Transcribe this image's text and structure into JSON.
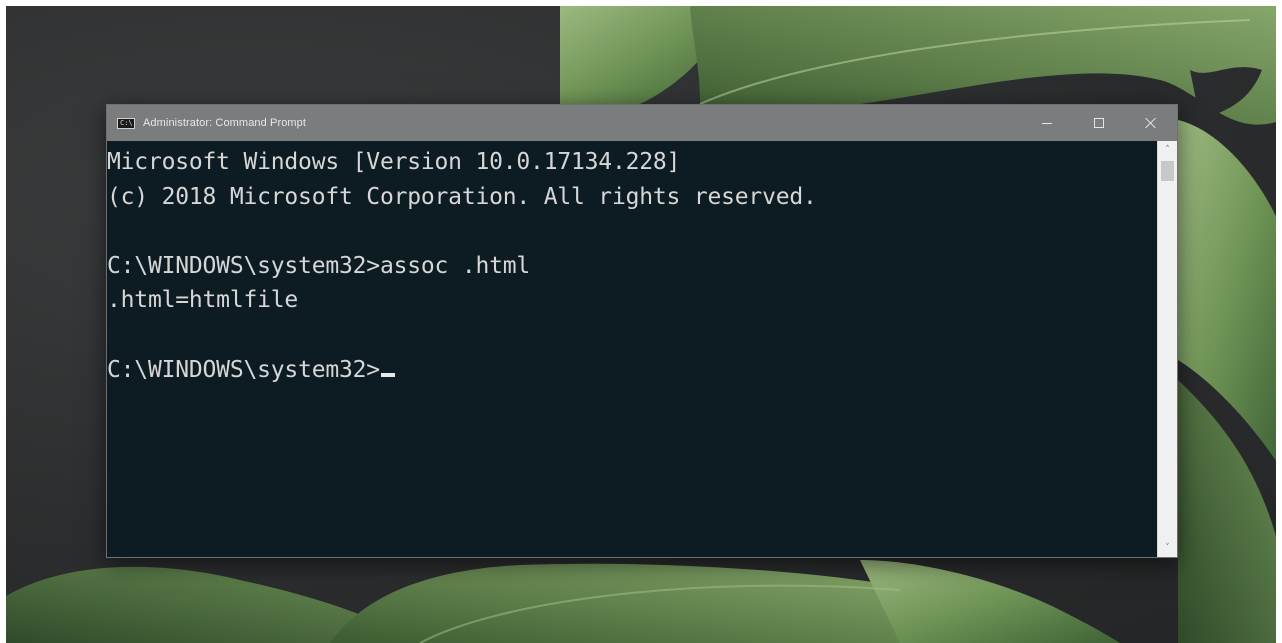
{
  "window": {
    "title": "Administrator: Command Prompt",
    "icon_label": "C:\\",
    "controls": {
      "minimize": "minimize-icon",
      "maximize": "maximize-icon",
      "close": "close-icon"
    }
  },
  "console": {
    "lines": [
      "Microsoft Windows [Version 10.0.17134.228]",
      "(c) 2018 Microsoft Corporation. All rights reserved.",
      "",
      "C:\\WINDOWS\\system32>assoc .html",
      ".html=htmlfile",
      "",
      "C:\\WINDOWS\\system32>"
    ]
  },
  "scrollbar": {
    "up_arrow": "˄",
    "down_arrow": "˅"
  },
  "colors": {
    "console_background": "#0c1c22",
    "console_text": "#d6d6d6",
    "titlebar": "#7a7c7d"
  }
}
